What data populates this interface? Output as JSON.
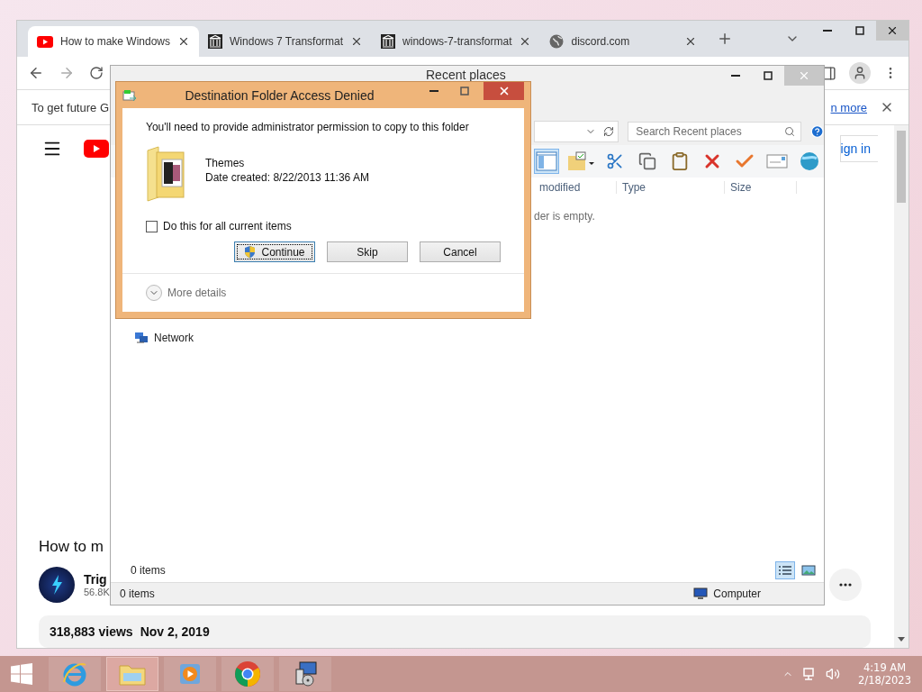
{
  "browser": {
    "tabs": [
      {
        "title": "How to make Windows",
        "selected": true,
        "kind": "video"
      },
      {
        "title": "Windows 7 Transformat",
        "selected": false,
        "kind": "archive"
      },
      {
        "title": "windows-7-transformat",
        "selected": false,
        "kind": "archive"
      },
      {
        "title": "discord.com",
        "selected": false,
        "kind": "web"
      }
    ],
    "info_bar": {
      "text": "To get future G",
      "link": "n more"
    },
    "sign_in": "ign in",
    "video_title": "How to m",
    "channel_name": "Trig",
    "subscribers": "56.8K",
    "views": "318,883 views",
    "date": "Nov 2, 2019"
  },
  "explorer": {
    "title": "Recent places",
    "search": {
      "placeholder": "Search Recent places"
    },
    "columns": [
      "modified",
      "Type",
      "Size"
    ],
    "empty_message": "der is empty.",
    "nav_items": [
      "Network"
    ],
    "item_count": "0 items",
    "view_modes": [
      {
        "kind": "details",
        "selected": true
      },
      {
        "kind": "tiles",
        "selected": false
      }
    ],
    "status": {
      "count": "0 items",
      "location": "Computer"
    }
  },
  "dialog": {
    "title": "Destination Folder Access Denied",
    "message": "You'll need to provide administrator permission to copy to this folder",
    "item": {
      "name": "Themes",
      "date": "Date created: 8/22/2013 11:36 AM"
    },
    "checkbox": {
      "label": "Do this for all current items",
      "checked": false
    },
    "buttons": [
      {
        "label": "Continue",
        "kind": "shield",
        "selected": true
      },
      {
        "label": "Skip",
        "kind": "plain",
        "selected": false
      },
      {
        "label": "Cancel",
        "kind": "plain",
        "selected": false
      }
    ],
    "details": {
      "label": "More details",
      "expanded": false
    }
  },
  "taskbar": {
    "apps": [
      {
        "kind": "ie",
        "selected": false
      },
      {
        "kind": "explorer",
        "selected": true
      },
      {
        "kind": "media",
        "selected": false
      },
      {
        "kind": "chrome",
        "selected": false
      },
      {
        "kind": "installer",
        "selected": false
      }
    ],
    "time": "4:19 AM",
    "date": "2/18/2023"
  }
}
